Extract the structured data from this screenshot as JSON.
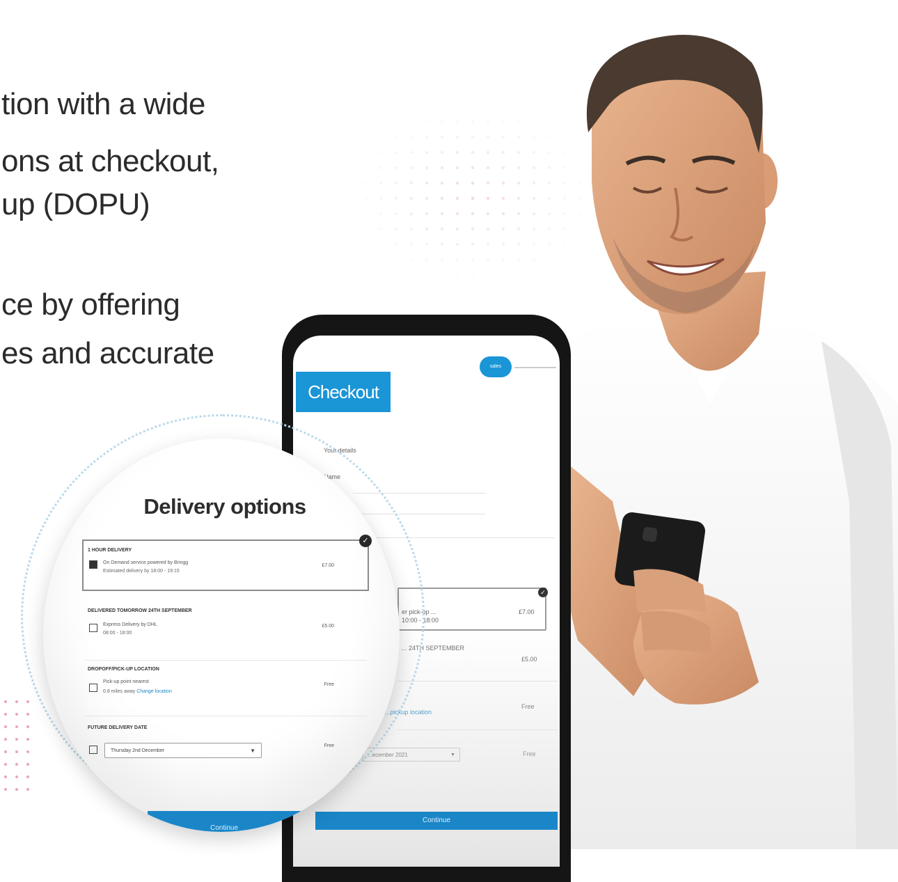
{
  "copy": {
    "line1": "tion with a wide",
    "line2": "ons at checkout,",
    "line3": "up (DOPU)",
    "line4": "ce by offering",
    "line5": "es and accurate"
  },
  "phone": {
    "logo_text": "sales",
    "checkout_label": "Checkout",
    "your_details": "Your details",
    "name_label": "Name",
    "partial_option_1": "er pick-up ...",
    "partial_option_1b": "10:00 - 18:00",
    "partial_option_2": "... 24TH SEPTEMBER",
    "partial_link": "...pickup location",
    "partial_select": "...ecember 2021",
    "price_1": "£7.00",
    "price_2": "£5.00",
    "price_3": "Free",
    "price_4": "Free",
    "continue_label": "Continue"
  },
  "delivery": {
    "title": "Delivery options",
    "options": [
      {
        "title": "1 HOUR DELIVERY",
        "line1": "On Demand service powered by Bringg",
        "line2": "Estimated delivery by 18:00 - 19:15",
        "price": "£7.00"
      },
      {
        "title": "DELIVERED TOMORROW 24TH SEPTEMBER",
        "line1": "Express Delivery by DHL",
        "line2": "08:00 - 18:00",
        "price": "£5.00"
      },
      {
        "title": "DROPOFF/PICK-UP LOCATION",
        "line1": "Pick-up point nearest",
        "line2": "0.8 miles away",
        "link": "Change location",
        "price": "Free"
      },
      {
        "title": "FUTURE DELIVERY DATE",
        "select": "Thursday 2nd December",
        "price": "Free"
      }
    ],
    "continue_label": "Continue"
  },
  "colors": {
    "brand_blue": "#1a95d6",
    "button_blue": "#1a86c8",
    "dot_blue": "#9ccfe6",
    "dot_pink": "#e8a7b4"
  }
}
